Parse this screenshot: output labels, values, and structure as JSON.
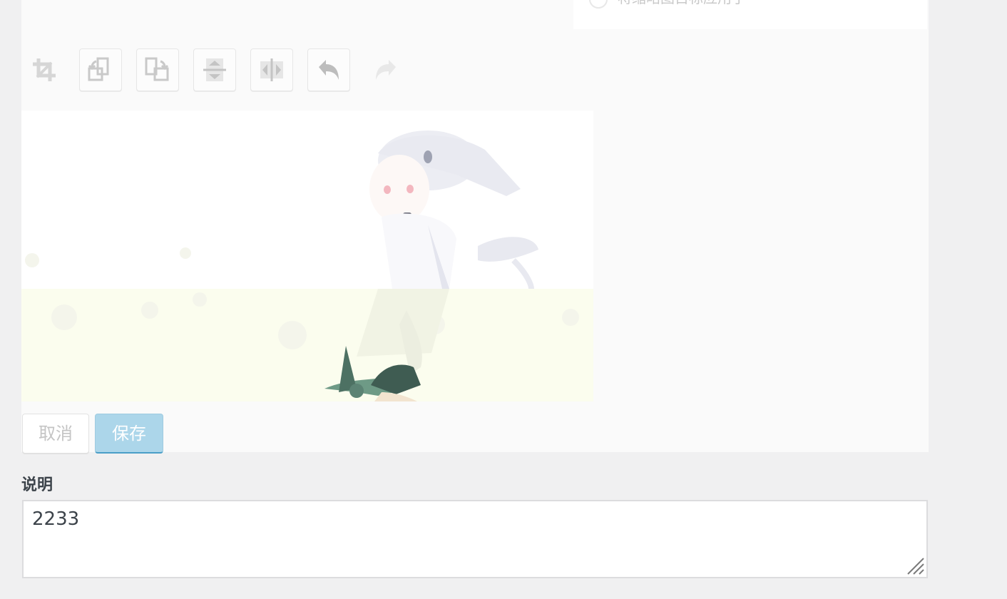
{
  "scale_option": {
    "label": "将缩略图目标应用于"
  },
  "toolbar": {
    "crop": "crop-icon",
    "rotate_left": "rotate-left-icon",
    "rotate_right": "rotate-right-icon",
    "flip_vertical": "flip-vertical-icon",
    "flip_horizontal": "flip-horizontal-icon",
    "undo": "undo-icon",
    "redo": "redo-icon"
  },
  "actions": {
    "cancel_label": "取消",
    "save_label": "保存"
  },
  "description": {
    "label": "说明",
    "value": "2233"
  },
  "colors": {
    "accent": "#acd6ea",
    "accent_border": "#4a9ec7",
    "panel_bg": "#fafafa",
    "page_bg": "#f0f0f1"
  }
}
